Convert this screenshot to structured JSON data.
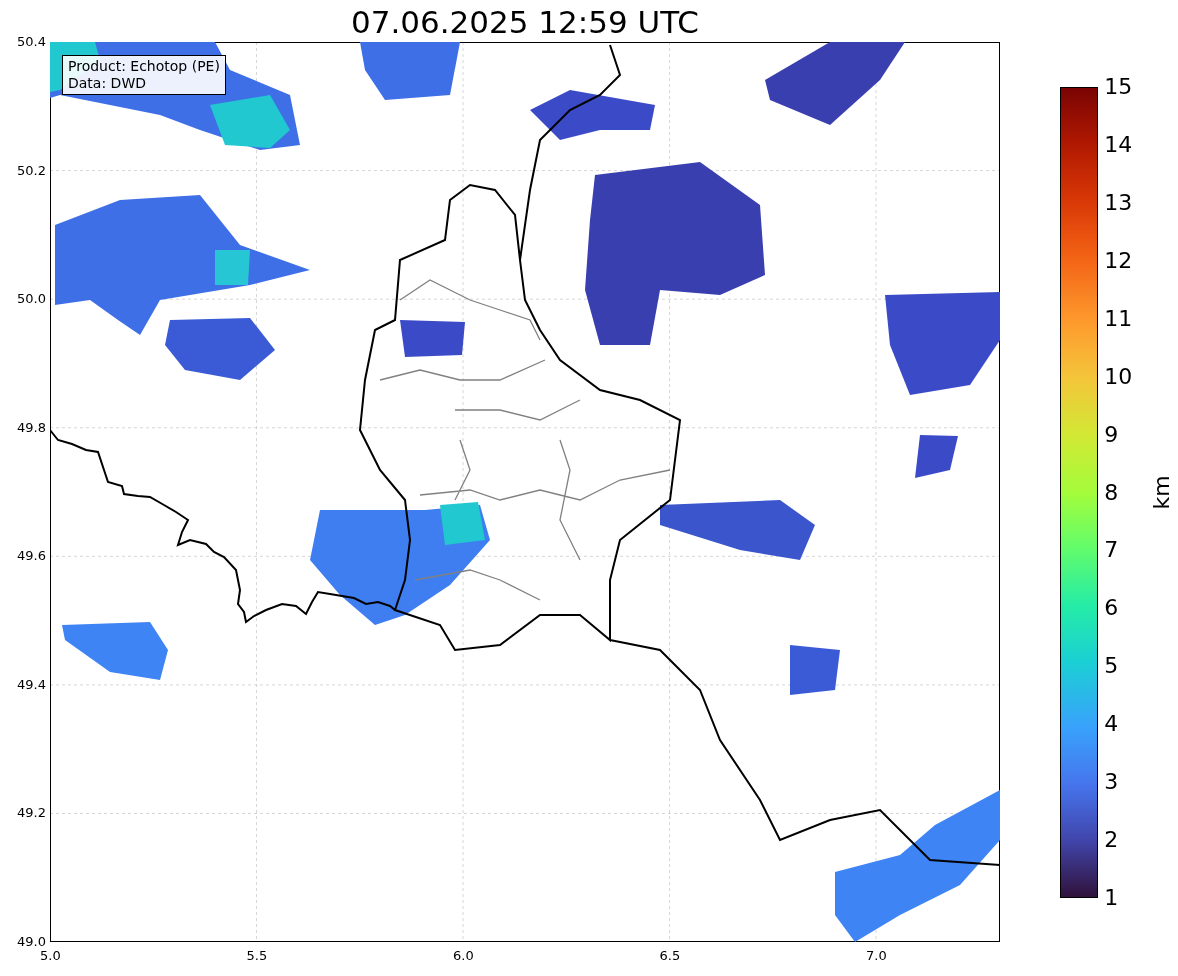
{
  "title": "07.06.2025 12:59 UTC",
  "info_box": [
    "Product: Echotop (PE)",
    "Data: DWD"
  ],
  "x_axis": {
    "ticks": [
      "5.0",
      "5.5",
      "6.0",
      "6.5",
      "7.0"
    ]
  },
  "y_axis": {
    "ticks": [
      "50.4",
      "50.2",
      "50.0",
      "49.8",
      "49.6",
      "49.4",
      "49.2",
      "49.0"
    ]
  },
  "colorbar": {
    "label": "km",
    "ticks": [
      "15",
      "14",
      "13",
      "12",
      "11",
      "10",
      "9",
      "8",
      "7",
      "6",
      "5",
      "4",
      "3",
      "2",
      "1"
    ]
  }
}
